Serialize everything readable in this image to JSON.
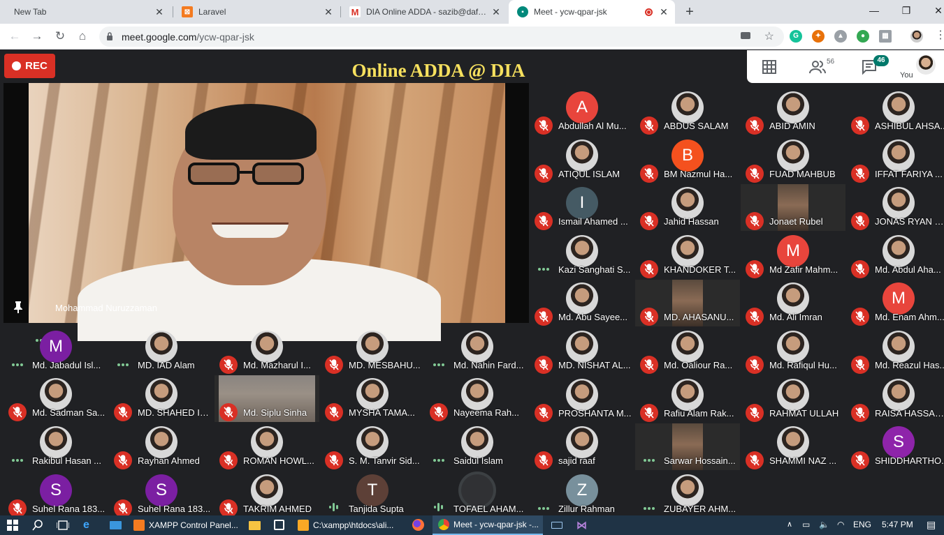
{
  "browser": {
    "tabs": [
      {
        "label": "New Tab",
        "favicon": "none",
        "active": false
      },
      {
        "label": "Laravel",
        "favicon": "xampp-icon",
        "color": "#f47b20",
        "active": false
      },
      {
        "label": "DIA Online ADDA - sazib@daffodil",
        "favicon": "gmail-icon",
        "color": "#d93025",
        "active": false
      },
      {
        "label": "Meet - ycw-qpar-jsk",
        "favicon": "meet-icon",
        "color": "#00897b",
        "active": true
      }
    ],
    "url_host": "meet.google.com",
    "url_path": "/ycw-qpar-jsk"
  },
  "meet": {
    "rec_label": "REC",
    "title": "Online ADDA @ DIA",
    "people_count": "56",
    "chat_count": "46",
    "you_label": "You",
    "featured_name": "Mohammad Nuruzzaman",
    "colors": {
      "mute": "#d93025",
      "talk": "#81c995",
      "title": "#f6e05e",
      "rec": "#d93025"
    }
  },
  "participants": [
    {
      "name": "Abdullah Al Mu...",
      "avatar": "letter",
      "letter": "A",
      "color": "#e8453c",
      "status": "muted"
    },
    {
      "name": "ABDUS SALAM",
      "avatar": "photo",
      "status": "muted"
    },
    {
      "name": "ABID AMIN",
      "avatar": "photo",
      "status": "muted"
    },
    {
      "name": "ASHIBUL AHSA...",
      "avatar": "photo",
      "status": "muted"
    },
    {
      "name": "ATIQUL ISLAM",
      "avatar": "photo",
      "status": "muted"
    },
    {
      "name": "BM Nazmul Ha...",
      "avatar": "letter",
      "letter": "B",
      "color": "#f4511e",
      "status": "muted"
    },
    {
      "name": "FUAD MAHBUB",
      "avatar": "photo",
      "status": "muted"
    },
    {
      "name": "IFFAT FARIYA ...",
      "avatar": "photo",
      "status": "muted"
    },
    {
      "name": "Ismail Ahamed ...",
      "avatar": "letter",
      "letter": "I",
      "color": "#455a64",
      "status": "muted"
    },
    {
      "name": "Jahid Hassan",
      "avatar": "photo",
      "status": "muted"
    },
    {
      "name": "Jonaet Rubel",
      "avatar": "cam",
      "status": "muted"
    },
    {
      "name": "JONAS RYAN G...",
      "avatar": "photo",
      "status": "muted"
    },
    {
      "name": "Kazi Sanghati S...",
      "avatar": "photo",
      "status": "talking"
    },
    {
      "name": "KHANDOKER T...",
      "avatar": "photo",
      "status": "muted"
    },
    {
      "name": "Md Zafir Mahm...",
      "avatar": "letter",
      "letter": "M",
      "color": "#e8453c",
      "status": "muted"
    },
    {
      "name": "Md. Abdul Aha...",
      "avatar": "photo",
      "status": "muted"
    },
    {
      "name": "Md. Abu Sayee...",
      "avatar": "photo",
      "status": "muted"
    },
    {
      "name": "MD. AHASANU...",
      "avatar": "cam",
      "status": "muted"
    },
    {
      "name": "Md. Ali Imran",
      "avatar": "photo",
      "status": "muted"
    },
    {
      "name": "Md. Enam Ahm...",
      "avatar": "letter",
      "letter": "M",
      "color": "#e8453c",
      "status": "muted"
    },
    {
      "name": "MD. NISHAT AL...",
      "avatar": "photo",
      "status": "muted"
    },
    {
      "name": "Md. Oaliour Ra...",
      "avatar": "photo",
      "status": "muted"
    },
    {
      "name": "Md. Rafiqul Hu...",
      "avatar": "photo",
      "status": "muted"
    },
    {
      "name": "Md. Reazul Has...",
      "avatar": "photo",
      "status": "muted"
    },
    {
      "name": "PROSHANTA M...",
      "avatar": "photo",
      "status": "muted"
    },
    {
      "name": "Rafiu Alam Rak...",
      "avatar": "photo",
      "status": "muted"
    },
    {
      "name": "RAHMAT ULLAH",
      "avatar": "photo",
      "status": "muted"
    },
    {
      "name": "RAISA HASSAN...",
      "avatar": "photo",
      "status": "muted"
    },
    {
      "name": "sajid raaf",
      "avatar": "photo",
      "status": "muted"
    },
    {
      "name": "Sarwar Hossain...",
      "avatar": "cam",
      "status": "talking"
    },
    {
      "name": "SHAMMI NAZ ...",
      "avatar": "photo",
      "status": "muted"
    },
    {
      "name": "SHIDDHARTHO...",
      "avatar": "letter",
      "letter": "S",
      "color": "#8e24aa",
      "status": "muted"
    },
    {
      "name": "Zillur Rahman",
      "avatar": "letter",
      "letter": "Z",
      "color": "#78909c",
      "status": "talking"
    },
    {
      "name": "ZUBAYER AHM...",
      "avatar": "photo",
      "status": "talking"
    },
    {
      "name": "Md. Jabadul Isl...",
      "avatar": "letter",
      "letter": "M",
      "color": "#7b1fa2",
      "status": "talking"
    },
    {
      "name": "MD. IAD Alam",
      "avatar": "photo",
      "status": "talking"
    },
    {
      "name": "Md. Mazharul I...",
      "avatar": "photo",
      "status": "muted"
    },
    {
      "name": "MD. MESBAHU...",
      "avatar": "photo",
      "status": "muted"
    },
    {
      "name": "Md. Nahin Fard...",
      "avatar": "photo",
      "status": "talking"
    },
    {
      "name": "Md. Sadman Sa...",
      "avatar": "photo",
      "status": "muted"
    },
    {
      "name": "MD. SHAHED IS...",
      "avatar": "photo",
      "status": "muted"
    },
    {
      "name": "Md. Siplu Sinha",
      "avatar": "cam-wide",
      "status": "muted"
    },
    {
      "name": "MYSHA TAMA...",
      "avatar": "photo",
      "status": "muted"
    },
    {
      "name": "Nayeema Rah...",
      "avatar": "photo",
      "status": "muted"
    },
    {
      "name": "Rakibul Hasan ...",
      "avatar": "photo",
      "status": "talking"
    },
    {
      "name": "Rayhan Ahmed",
      "avatar": "photo",
      "status": "muted"
    },
    {
      "name": "ROMAN HOWL...",
      "avatar": "photo",
      "status": "muted"
    },
    {
      "name": "S. M. Tanvir Sid...",
      "avatar": "photo",
      "status": "muted"
    },
    {
      "name": "Saidul Islam",
      "avatar": "photo",
      "status": "talking"
    },
    {
      "name": "Suhel Rana 183...",
      "avatar": "letter",
      "letter": "S",
      "color": "#7b1fa2",
      "status": "muted"
    },
    {
      "name": "Suhel Rana 183...",
      "avatar": "letter",
      "letter": "S",
      "color": "#7b1fa2",
      "status": "muted"
    },
    {
      "name": "TAKRIM AHMED",
      "avatar": "photo",
      "status": "muted"
    },
    {
      "name": "Tanjida Supta",
      "avatar": "letter",
      "letter": "T",
      "color": "#5d4037",
      "status": "speaking"
    },
    {
      "name": "TOFAEL AHAM...",
      "avatar": "letter",
      "letter": "",
      "color": "#303134",
      "status": "speaking"
    }
  ],
  "taskbar": {
    "items": [
      {
        "label": "XAMPP Control Panel...",
        "icon": "xampp-icon",
        "color": "#f47b20"
      },
      {
        "label": "C:\\xampp\\htdocs\\ali...",
        "icon": "sublime-icon",
        "color": "#f9a825"
      },
      {
        "label": "Meet - ycw-qpar-jsk -...",
        "icon": "chrome-icon",
        "color": "#4285f4"
      }
    ],
    "lang": "ENG",
    "time": "5:47 PM"
  }
}
